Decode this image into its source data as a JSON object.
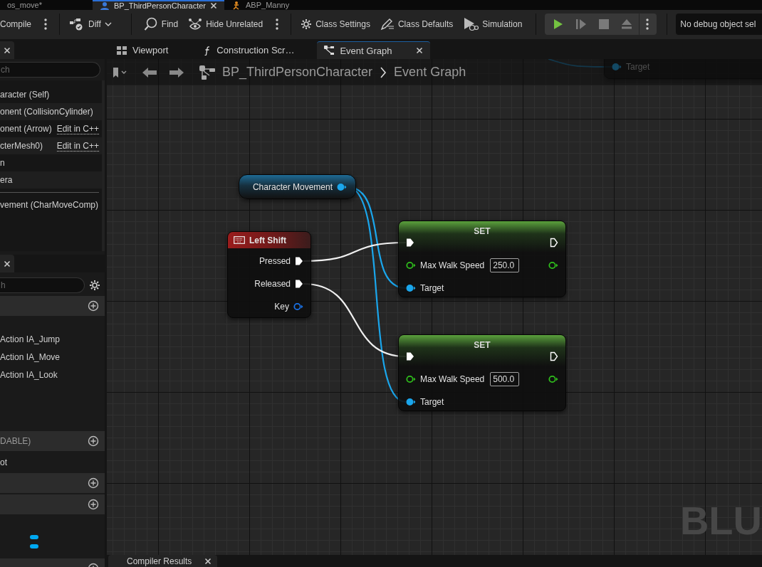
{
  "document_tabs": [
    {
      "label": "os_move*",
      "kind": "plain",
      "selected": false
    },
    {
      "label": "BP_ThirdPersonCharacter",
      "kind": "blueprint",
      "selected": true
    },
    {
      "label": "ABP_Manny",
      "kind": "animation",
      "selected": false
    }
  ],
  "toolbar": [
    {
      "label": "Compile",
      "kind": "compile"
    },
    {
      "kind": "more"
    },
    {
      "label": "Diff",
      "kind": "diff"
    },
    {
      "label": "Find",
      "kind": "find"
    },
    {
      "label": "Hide Unrelated",
      "kind": "hide"
    },
    {
      "kind": "more"
    },
    {
      "label": "Class Settings",
      "kind": "settings"
    },
    {
      "label": "Class Defaults",
      "kind": "defaults"
    },
    {
      "label": "Simulation",
      "kind": "simulation"
    }
  ],
  "play_controls": [
    {
      "kind": "play",
      "disabled": false
    },
    {
      "kind": "step",
      "disabled": true
    },
    {
      "kind": "stop",
      "disabled": true
    },
    {
      "kind": "eject",
      "disabled": true
    },
    {
      "kind": "more"
    }
  ],
  "debug_filter": {
    "value": "No debug object sel"
  },
  "components_panel": {
    "search": {
      "placeholder": "ch"
    },
    "items": [
      {
        "kind": "component",
        "label": "aracter (Self)"
      },
      {
        "kind": "component",
        "label": "onent (CollisionCylinder)"
      },
      {
        "kind": "component",
        "label": "onent (Arrow)",
        "link": "Edit in C++"
      },
      {
        "kind": "component",
        "label": "cterMesh0)",
        "link": "Edit in C++"
      },
      {
        "kind": "component",
        "label": "n"
      },
      {
        "kind": "component",
        "label": "era"
      },
      {
        "kind": "separator"
      },
      {
        "kind": "component",
        "label": "vement (CharMoveComp)"
      }
    ]
  },
  "blueprint_panel": {
    "search": {
      "placeholder": "h"
    },
    "sections": [
      {
        "kind": "category",
        "items": [
          {
            "kind": "text",
            "label": "Action IA_Jump"
          },
          {
            "kind": "text",
            "label": "Action IA_Move"
          },
          {
            "kind": "text",
            "label": "Action IA_Look"
          }
        ]
      },
      {
        "kind": "category",
        "title": "DABLE)",
        "items": [
          {
            "kind": "text",
            "label": "ot"
          }
        ]
      },
      {
        "kind": "category"
      },
      {
        "kind": "category",
        "items": [
          {
            "kind": "variable",
            "color": "#00a8f0"
          },
          {
            "kind": "variable",
            "color": "#00a8f0"
          }
        ]
      },
      {
        "kind": "category"
      }
    ]
  },
  "graph_tabs": [
    {
      "label": "Viewport",
      "kind": "viewport",
      "selected": false,
      "closable": false
    },
    {
      "label": "Construction Scr…",
      "kind": "function",
      "selected": false,
      "closable": false
    },
    {
      "label": "Event Graph",
      "kind": "graph",
      "selected": true,
      "closable": true
    }
  ],
  "graph": {
    "breadcrumb": [
      "BP_ThirdPersonCharacter",
      "Event Graph"
    ],
    "nodes": [
      {
        "kind": "partial",
        "rows": [
          {
            "in": {
              "label": "Target",
              "kind": "object",
              "connected": true
            }
          }
        ]
      },
      {
        "kind": "variable",
        "title": "Character Movement",
        "rows": [
          {
            "out": {
              "kind": "object",
              "connected": true
            }
          }
        ]
      },
      {
        "kind": "event",
        "title": "Left Shift",
        "rows": [
          {
            "out": {
              "label": "Pressed",
              "kind": "exec",
              "connected": true
            }
          },
          {
            "out": {
              "label": "Released",
              "kind": "exec",
              "connected": true
            }
          },
          {
            "out": {
              "label": "Key",
              "kind": "key",
              "connected": false
            }
          }
        ]
      },
      {
        "kind": "set",
        "title": "SET",
        "rows": [
          {
            "in": {
              "kind": "exec",
              "connected": true
            },
            "out": {
              "kind": "exec",
              "connected": false
            }
          },
          {
            "in": {
              "label": "Max Walk Speed",
              "kind": "float",
              "connected": false,
              "value": "250.0"
            },
            "out": {
              "kind": "float",
              "connected": false
            }
          },
          {
            "in": {
              "label": "Target",
              "kind": "object",
              "connected": true
            }
          }
        ]
      },
      {
        "kind": "set",
        "title": "SET",
        "rows": [
          {
            "in": {
              "kind": "exec",
              "connected": true
            },
            "out": {
              "kind": "exec",
              "connected": false
            }
          },
          {
            "in": {
              "label": "Max Walk Speed",
              "kind": "float",
              "connected": false,
              "value": "500.0"
            },
            "out": {
              "kind": "float",
              "connected": false
            }
          },
          {
            "in": {
              "label": "Target",
              "kind": "object",
              "connected": true
            }
          }
        ]
      }
    ],
    "corner_text": "BLU"
  },
  "bottom_tabs": [
    {
      "label": "Compiler Results",
      "selected": true
    }
  ]
}
